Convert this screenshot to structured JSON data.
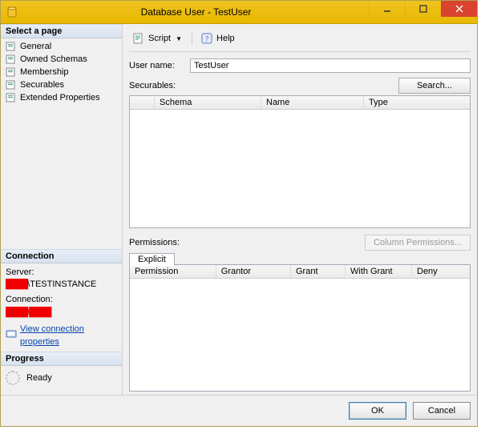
{
  "window": {
    "title": "Database User - TestUser"
  },
  "left": {
    "select_page_header": "Select a page",
    "pages": [
      {
        "label": "General"
      },
      {
        "label": "Owned Schemas"
      },
      {
        "label": "Membership"
      },
      {
        "label": "Securables"
      },
      {
        "label": "Extended Properties"
      }
    ],
    "connection_header": "Connection",
    "server_label": "Server:",
    "server_value_redacted": "████\\TESTINSTANCE",
    "connection_label": "Connection:",
    "connection_value_redacted": "████\\████",
    "view_conn_props": "View connection properties",
    "progress_header": "Progress",
    "progress_status": "Ready"
  },
  "toolbar": {
    "script_label": "Script",
    "help_label": "Help"
  },
  "form": {
    "username_label": "User name:",
    "username_value": "TestUser",
    "securables_label": "Securables:",
    "search_button": "Search...",
    "securables_cols": {
      "schema": "Schema",
      "name": "Name",
      "type": "Type"
    },
    "permissions_label": "Permissions:",
    "column_perms_button": "Column Permissions...",
    "tab_explicit": "Explicit",
    "perm_cols": {
      "permission": "Permission",
      "grantor": "Grantor",
      "grant": "Grant",
      "with_grant": "With Grant",
      "deny": "Deny"
    }
  },
  "footer": {
    "ok": "OK",
    "cancel": "Cancel"
  }
}
